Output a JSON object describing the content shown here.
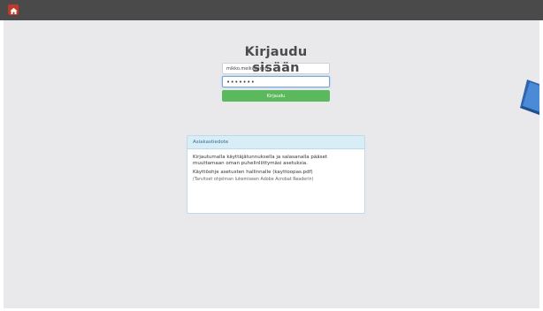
{
  "topbar": {
    "home_icon": "home-icon",
    "colors": {
      "bar": "#4a4a4a",
      "home_button": "#c0392b"
    }
  },
  "login": {
    "title": "Kirjaudu sisään",
    "username_value": "mikko.meikäläinen",
    "password_value": "•••••••",
    "submit_label": "Kirjaudu",
    "colors": {
      "submit": "#5cb85c",
      "focus_border": "#78a7d6"
    }
  },
  "notice": {
    "heading": "Asiakastiedote",
    "paragraph1": "Kirjautumalla käyttäjätunnuksella ja salasanalla pääset muuttamaan oman puhelinliittymäsi asetuksia.",
    "guide_prefix": "Käyttöohje asetusten hallinnalle ",
    "guide_link": "(kayttoopas.pdf)",
    "guide_hint": "(Tarvitset ohjelman lukemiseen Adobe Acrobat Readerin)",
    "colors": {
      "header_bg": "#d9edf7",
      "header_text": "#31708f"
    }
  },
  "decoration": {
    "icon": "book-icon",
    "color": "#3d7cc9"
  }
}
